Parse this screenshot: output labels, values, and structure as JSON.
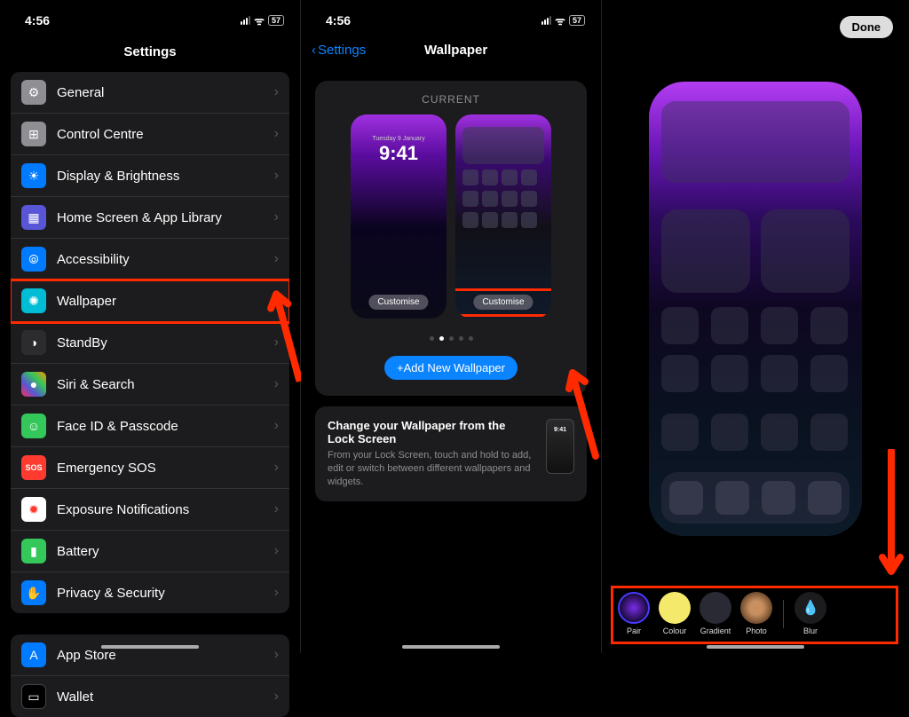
{
  "status": {
    "time": "4:56",
    "battery": "57"
  },
  "panel1": {
    "title": "Settings",
    "rows": [
      {
        "icon": "ic-gray",
        "glyph": "⚙",
        "label": "General"
      },
      {
        "icon": "ic-gray",
        "glyph": "⊞",
        "label": "Control Centre"
      },
      {
        "icon": "ic-blue",
        "glyph": "☀",
        "label": "Display & Brightness"
      },
      {
        "icon": "ic-purple",
        "glyph": "▦",
        "label": "Home Screen & App Library"
      },
      {
        "icon": "ic-blue",
        "glyph": "⦾",
        "label": "Accessibility"
      },
      {
        "icon": "ic-cyan",
        "glyph": "✺",
        "label": "Wallpaper",
        "highlight": true
      },
      {
        "icon": "ic-dgray",
        "glyph": "◑",
        "label": "StandBy"
      },
      {
        "icon": "ic-multi",
        "glyph": "●",
        "label": "Siri & Search"
      },
      {
        "icon": "ic-green",
        "glyph": "☺",
        "label": "Face ID & Passcode"
      },
      {
        "icon": "ic-sos",
        "glyph": "SOS",
        "label": "Emergency SOS"
      },
      {
        "icon": "ic-white",
        "glyph": "✹",
        "label": "Exposure Notifications"
      },
      {
        "icon": "ic-batgreen",
        "glyph": "▮",
        "label": "Battery"
      },
      {
        "icon": "ic-hand",
        "glyph": "✋",
        "label": "Privacy & Security"
      }
    ],
    "rows2": [
      {
        "icon": "ic-store",
        "glyph": "A",
        "label": "App Store"
      },
      {
        "icon": "ic-wallet",
        "glyph": "▭",
        "label": "Wallet"
      }
    ]
  },
  "panel2": {
    "back": "Settings",
    "title": "Wallpaper",
    "current": "CURRENT",
    "lock": {
      "date": "Tuesday 9 January",
      "time": "9:41"
    },
    "customise": "Customise",
    "add": "+Add New Wallpaper",
    "hint": {
      "title": "Change your Wallpaper from the Lock Screen",
      "body": "From your Lock Screen, touch and hold to add, edit or switch between different wallpapers and widgets.",
      "minitime": "9:41"
    }
  },
  "panel3": {
    "done": "Done",
    "tools": {
      "pair": "Pair",
      "colour": "Colour",
      "gradient": "Gradient",
      "photo": "Photo",
      "blur": "Blur"
    }
  }
}
